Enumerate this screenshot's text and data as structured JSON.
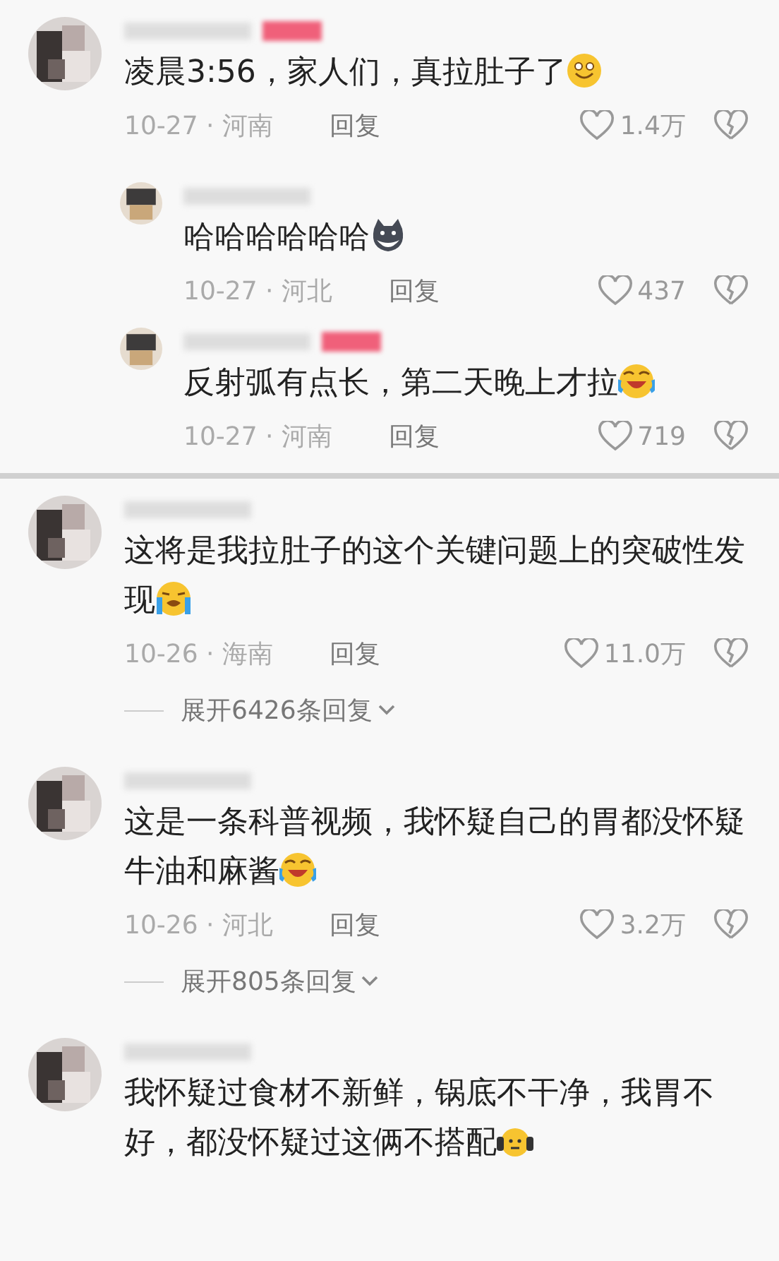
{
  "panels": [
    {
      "comments": [
        {
          "name_badge": true,
          "text": "凌晨3:56，家人们，真拉肚子了",
          "emoji": {
            "kind": "smile"
          },
          "date": "10-27 · 河南",
          "reply": "回复",
          "likes": "1.4万",
          "replies": [
            {
              "name_badge": false,
              "text": "哈哈哈哈哈哈",
              "emoji": {
                "kind": "husky"
              },
              "date": "10-27 · 河北",
              "reply": "回复",
              "likes": "437"
            },
            {
              "name_badge": true,
              "text": "反射弧有点长，第二天晚上才拉",
              "emoji": {
                "kind": "laugh-cry"
              },
              "date": "10-27 · 河南",
              "reply": "回复",
              "likes": "719"
            }
          ]
        }
      ]
    },
    {
      "comments": [
        {
          "name_badge": false,
          "text": "这将是我拉肚子的这个关键问题上的突破性发现",
          "emoji": {
            "kind": "cry"
          },
          "date": "10-26 · 海南",
          "reply": "回复",
          "likes": "11.0万",
          "expand": "展开6426条回复"
        },
        {
          "name_badge": false,
          "text": "这是一条科普视频，我怀疑自己的胃都没怀疑牛油和麻酱",
          "emoji": {
            "kind": "laugh-cry"
          },
          "date": "10-26 · 河北",
          "reply": "回复",
          "likes": "3.2万",
          "expand": "展开805条回复"
        },
        {
          "name_badge": false,
          "text": "我怀疑过食材不新鲜，锅底不干净，我胃不好，都没怀疑过这俩不搭配",
          "emoji": {
            "kind": "headphones"
          }
        }
      ]
    }
  ]
}
